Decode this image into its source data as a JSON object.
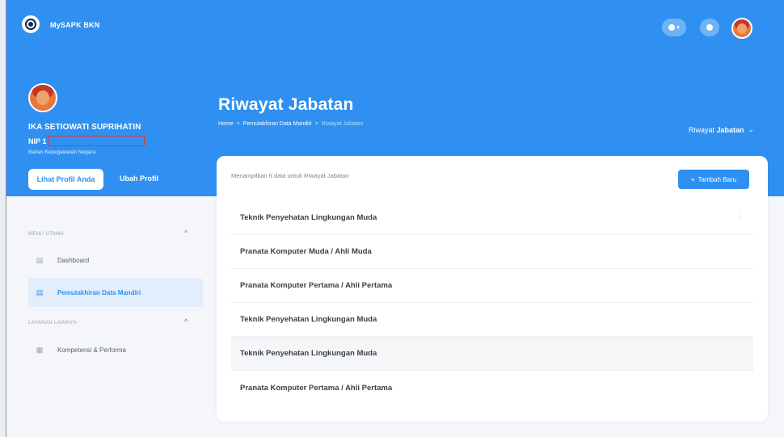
{
  "app": {
    "name": "MySAPK BKN"
  },
  "topbar": {
    "theme_icon": "half-moon-icon",
    "notification_icon": "bell-icon",
    "user_avatar": "user-avatar"
  },
  "profile": {
    "name": "IKA SETIOWATI SUPRIHATIN",
    "nip_label": "NIP 1",
    "org": "Badan Kepegawaian Negara",
    "view_profile_label": "Lihat Profil Anda",
    "edit_profile_label": "Ubah Profil"
  },
  "page": {
    "title": "Riwayat Jabatan",
    "breadcrumb": {
      "home": "Home",
      "sep1": ">",
      "parent": "Pemutakhiran Data Mandiri",
      "sep2": ">",
      "current": "Riwayat Jabatan"
    },
    "dropdown": {
      "prefix": "Riwayat",
      "value": "Jabatan",
      "caret": "⌄"
    }
  },
  "sidebar": {
    "section1": {
      "title": "MENU UTAMA",
      "caret": "^",
      "items": [
        {
          "label": "Dashboard",
          "icon": "grid-icon"
        },
        {
          "label": "Pemutakhiran Data Mandiri",
          "icon": "document-icon"
        }
      ]
    },
    "section2": {
      "title": "LAYANAN LAINNYA",
      "caret": "^",
      "items": [
        {
          "label": "Kompetensi & Performa",
          "icon": "apps-icon"
        }
      ]
    }
  },
  "card": {
    "info": "Menampilkan 6 data untuk Riwayat Jabatan",
    "add_button": "Tambah Baru",
    "add_icon": "+",
    "row_menu_icon": "⋮",
    "rows": [
      {
        "label": "Teknik Penyehatan Lingkungan Muda",
        "sub": ""
      },
      {
        "label": "Pranata Komputer Muda / ",
        "sub": "Ahli Muda"
      },
      {
        "label": "Pranata Komputer Pertama / ",
        "sub": "Ahli Pertama"
      },
      {
        "label": "Teknik Penyehatan Lingkungan Muda",
        "sub": ""
      },
      {
        "label": "Teknik Penyehatan Lingkungan Muda",
        "sub": ""
      },
      {
        "label": "Pranata Komputer Pertama / ",
        "sub": "Ahli Pertama"
      }
    ]
  },
  "colors": {
    "primary": "#2f90f2",
    "background": "#f4f6fa",
    "active_item_bg": "#e3eefc"
  }
}
